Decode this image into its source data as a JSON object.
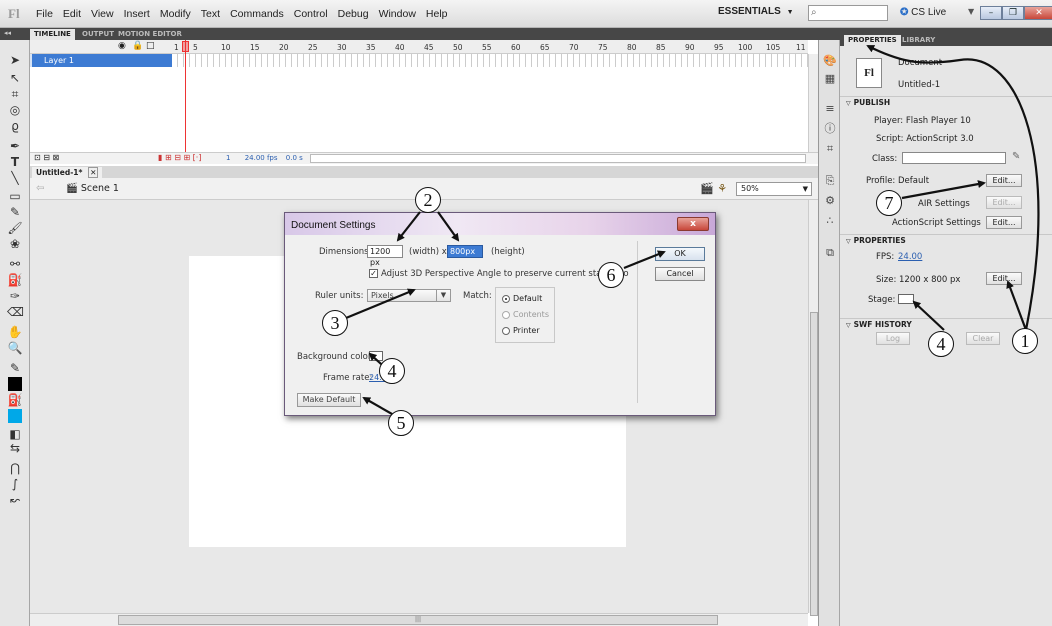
{
  "app": {
    "logo": "Fl"
  },
  "menu": [
    "File",
    "Edit",
    "View",
    "Insert",
    "Modify",
    "Text",
    "Commands",
    "Control",
    "Debug",
    "Window",
    "Help"
  ],
  "workspace": {
    "label": "ESSENTIALS",
    "arrow": "▼"
  },
  "cs_live": {
    "label": "CS Live",
    "arrow": "▼"
  },
  "timeline": {
    "tabs": [
      "TIMELINE",
      "OUTPUT",
      "MOTION EDITOR"
    ],
    "ruler": [
      "1",
      "5",
      "10",
      "15",
      "20",
      "25",
      "30",
      "35",
      "40",
      "45",
      "50",
      "55",
      "60",
      "65",
      "70",
      "75",
      "80",
      "85",
      "90",
      "95",
      "100",
      "105",
      "11"
    ],
    "layer_name": "Layer 1",
    "status_frame": "1",
    "status_fps": "24.00 fps",
    "status_time": "0.0 s"
  },
  "document": {
    "tab": "Untitled-1*",
    "scene": "Scene 1",
    "zoom": "50%"
  },
  "dialog": {
    "title": "Document Settings",
    "close": "x",
    "dimensions_label": "Dimensions:",
    "width_value": "1200 px",
    "width_unit": "(width) x",
    "height_value": "800px",
    "height_unit": "(height)",
    "adjust_3d": "Adjust 3D Perspective Angle to preserve current stage pro",
    "ruler_label": "Ruler units:",
    "ruler_value": "Pixels",
    "match_label": "Match:",
    "match_options": [
      "Default",
      "Contents",
      "Printer"
    ],
    "bg_label": "Background color:",
    "frame_rate_label": "Frame rate:",
    "frame_rate_value": "24.00",
    "make_default": "Make Default",
    "ok": "OK",
    "cancel": "Cancel"
  },
  "properties": {
    "tabs": [
      "PROPERTIES",
      "LIBRARY"
    ],
    "doc_icon": "Fl",
    "doc_type": "Document",
    "doc_name": "Untitled-1",
    "publish_head": "PUBLISH",
    "player": "Player:  Flash Player 10",
    "script": "Script:  ActionScript 3.0",
    "class_label": "Class:",
    "profile": "Profile:  Default",
    "edit": "Edit...",
    "air_settings": "AIR Settings",
    "as_settings": "ActionScript Settings",
    "props_head": "PROPERTIES",
    "fps_label": "FPS:",
    "fps_value": "24.00",
    "size": "Size:  1200 x 800 px",
    "stage_label": "Stage:",
    "swf_head": "SWF HISTORY",
    "log": "Log",
    "clear": "Clear"
  },
  "callouts": [
    "1",
    "2",
    "3",
    "4",
    "4",
    "5",
    "6",
    "7"
  ]
}
